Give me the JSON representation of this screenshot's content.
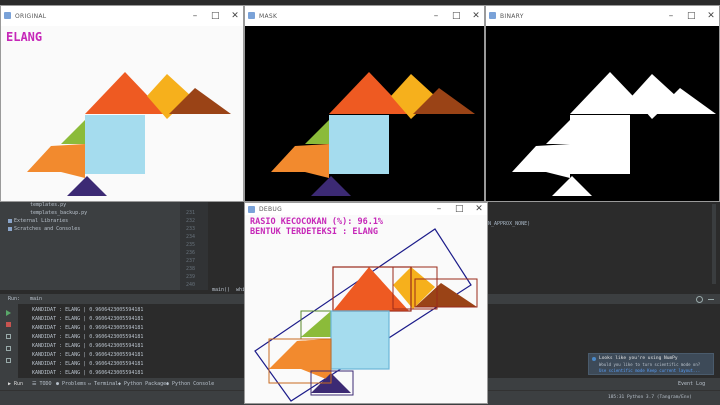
{
  "windows": {
    "original": {
      "title": "ORIGINAL",
      "label": "ELANG"
    },
    "mask": {
      "title": "MASK"
    },
    "binary": {
      "title": "BINARY"
    },
    "debug": {
      "title": "DEBUG",
      "line1": "RASIO KECOCOKAN (%): 96.1%",
      "line2": "BENTUK TERDETEKSI : ELANG"
    }
  },
  "ide": {
    "tree": [
      "templates.py",
      "templates_backup.py",
      "External Libraries",
      "Scratches and Consoles"
    ],
    "line_numbers": [
      "231",
      "232",
      "233",
      "234",
      "235",
      "236",
      "237",
      "238",
      "239",
      "240"
    ],
    "code_snippet": "N_APPROX_NONE)",
    "breadcrumbs": [
      "main()",
      "while"
    ],
    "run_label": "Run:",
    "run_tab": "main",
    "console_lines": [
      "KANDIDAT : ELANG | 0.9606423005594181",
      "KANDIDAT : ELANG | 0.9606423005594181",
      "KANDIDAT : ELANG | 0.9606423005594181",
      "KANDIDAT : ELANG | 0.9606423005594181",
      "KANDIDAT : ELANG | 0.9606423005594181",
      "KANDIDAT : ELANG | 0.9606423005594181",
      "KANDIDAT : ELANG | 0.9606423005594181",
      "KANDIDAT : ELANG | 0.9606423005594181"
    ],
    "bottom_tabs": [
      "Run",
      "TODO",
      "Problems",
      "Terminal",
      "Python Packages",
      "Python Console"
    ],
    "event_log": "Event Log",
    "status_right": "185:31   Python 3.7 (Tangram/Env)",
    "notification": {
      "title": "Looks like you're using NumPy",
      "body": "Would you like to turn scientific mode on?",
      "actions": "Use scientific mode   Keep current layout..."
    }
  },
  "colors": {
    "magenta": "#c627b8",
    "orange_dark": "#ee5a22",
    "orange": "#f28a2e",
    "yellow": "#f6b01c",
    "brown": "#9a4316",
    "green": "#8bbb3a",
    "light_blue": "#a5dcee",
    "purple": "#3c2a74"
  }
}
